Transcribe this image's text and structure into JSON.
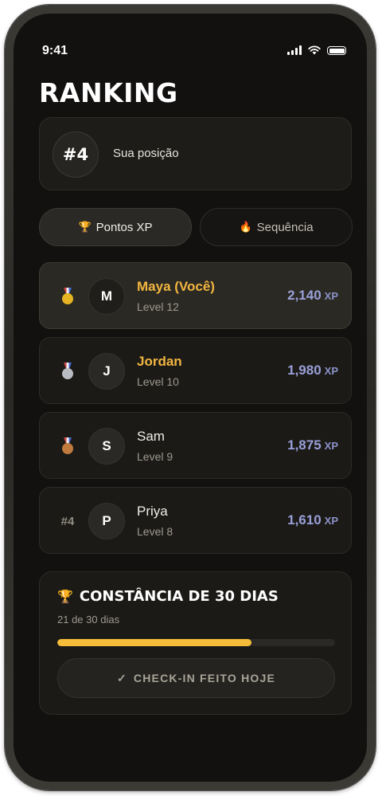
{
  "status": {
    "time": "9:41"
  },
  "title": "RANKING",
  "position": {
    "badge": "#4",
    "label": "Sua posição"
  },
  "tabs": [
    {
      "icon": "trophy-icon",
      "emoji": "🏆",
      "label": "Pontos XP",
      "active": true
    },
    {
      "icon": "fire-icon",
      "emoji": "🔥",
      "label": "Sequência",
      "active": false
    }
  ],
  "leaderboard": [
    {
      "rank": "1",
      "medal": "gold-medal-icon",
      "initial": "M",
      "name": "Maya (Você)",
      "level": "Level 12",
      "xp": "2,140",
      "unit": "XP",
      "highlight": true,
      "me": true
    },
    {
      "rank": "2",
      "medal": "silver-medal-icon",
      "initial": "J",
      "name": "Jordan",
      "level": "Level 10",
      "xp": "1,980",
      "unit": "XP",
      "highlight": true,
      "me": false
    },
    {
      "rank": "3",
      "medal": "bronze-medal-icon",
      "initial": "S",
      "name": "Sam",
      "level": "Level 9",
      "xp": "1,875",
      "unit": "XP",
      "highlight": false,
      "me": false
    },
    {
      "rank": "#4",
      "medal": "",
      "initial": "P",
      "name": "Priya",
      "level": "Level 8",
      "xp": "1,610",
      "unit": "XP",
      "highlight": false,
      "me": false
    }
  ],
  "streak": {
    "icon": "trophy-icon",
    "emoji": "🏆",
    "title": "CONSTÂNCIA DE 30 DIAS",
    "subtitle": "21 de 30 dias",
    "progress": 0.7,
    "button_check": "✓",
    "button_label": "CHECK-IN FEITO HOJE"
  },
  "colors": {
    "accent": "#f2b640",
    "xp": "#9aa0d8",
    "progress": "#f5bd3a"
  }
}
